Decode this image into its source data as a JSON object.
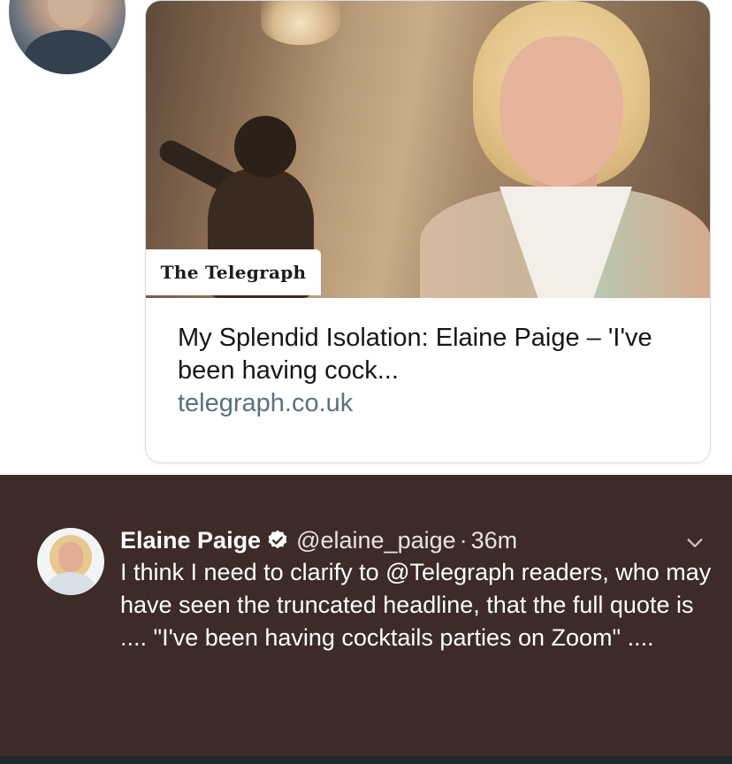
{
  "link_card": {
    "brand_name": "The Telegraph",
    "headline": "My Splendid Isolation: Elaine Paige – 'I've been having cock...",
    "domain": "telegraph.co.uk"
  },
  "tweet": {
    "author_name": "Elaine Paige",
    "handle": "@elaine_paige",
    "separator": "·",
    "time": "36m",
    "text": "I think I need to clarify to @Telegraph readers, who may have seen the truncated headline, that the full quote is .... \"I've been having cocktails parties on Zoom\" ...."
  },
  "colors": {
    "dark_background": "#3c2b26",
    "verified_badge": "#ffffff",
    "link_domain": "#5b7083"
  },
  "icons": {
    "verified": "verified-badge-icon",
    "more": "chevron-down-icon"
  }
}
